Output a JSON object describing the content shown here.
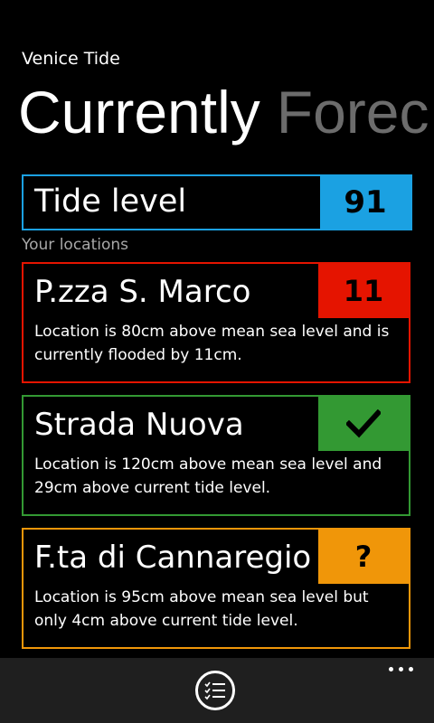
{
  "app": {
    "title": "Venice Tide"
  },
  "pivot": {
    "tabs": [
      {
        "label": "Currently",
        "active": true
      },
      {
        "label": "Forec",
        "active": false
      }
    ]
  },
  "tide": {
    "label": "Tide level",
    "value": "91",
    "color": "#1ba1e2"
  },
  "locations": {
    "header": "Your locations",
    "items": [
      {
        "name": "P.zza S. Marco",
        "badge": "11",
        "status": "flooded",
        "color": "#e51400",
        "description": "Location is 80cm above mean sea level and is currently flooded by 11cm."
      },
      {
        "name": "Strada Nuova",
        "badge_icon": "checkmark-icon",
        "status": "safe",
        "color": "#339933",
        "description": "Location is 120cm above mean sea level and 29cm above current tide level."
      },
      {
        "name": "F.ta di Cannaregio",
        "badge": "?",
        "status": "warning",
        "color": "#f09609",
        "description": "Location is 95cm above mean sea level but only 4cm above current tide level."
      }
    ]
  },
  "app_bar": {
    "button_icon": "list-icon",
    "more_icon": "ellipsis-icon",
    "background": "#1f1f1f"
  }
}
